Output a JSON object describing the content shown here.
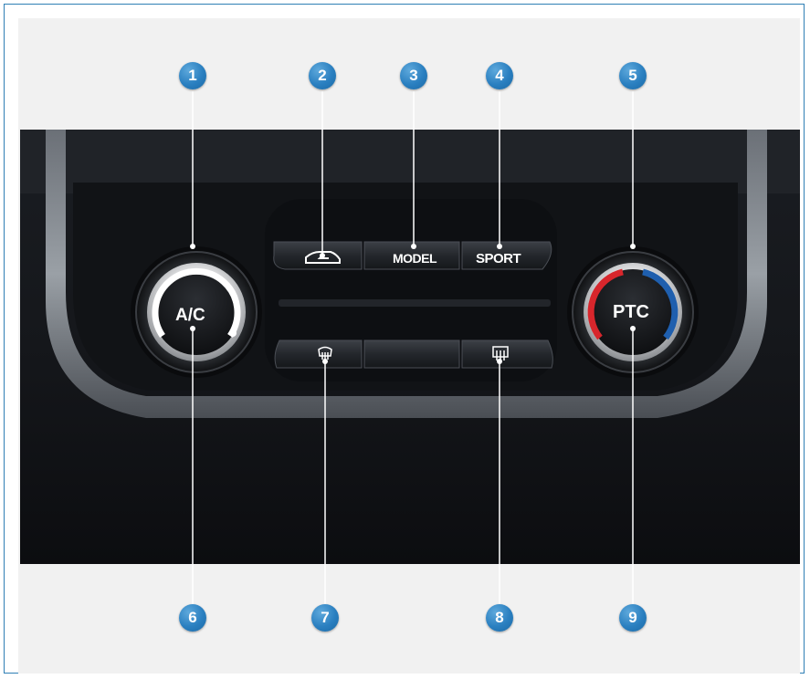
{
  "callouts": [
    "1",
    "2",
    "3",
    "4",
    "5",
    "6",
    "7",
    "8",
    "9"
  ],
  "controls": {
    "ac_knob_label": "A/C",
    "ptc_knob_label": "PTC",
    "model_button_label": "MODEL",
    "sport_button_label": "SPORT",
    "recirculation_icon": "air-recirculation-icon",
    "front_defrost_icon": "front-windshield-defrost-icon",
    "rear_defrost_icon": "rear-window-defrost-icon",
    "fan_icon": "fan-icon"
  },
  "colors": {
    "callout_blue": "#2a7fc0",
    "border_blue": "#2f7fb5",
    "heat_red": "#d8262c",
    "cool_blue": "#1f5fae"
  }
}
